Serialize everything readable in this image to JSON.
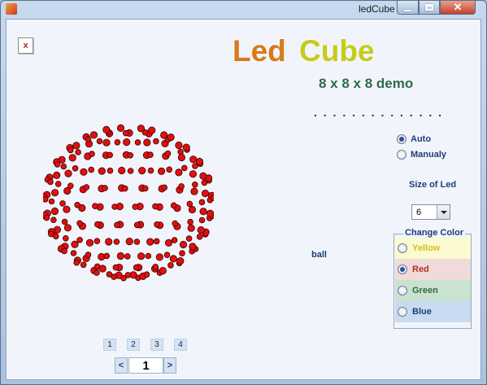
{
  "window": {
    "title": "ledCube"
  },
  "close_x": "x",
  "heading": {
    "led": "Led",
    "cube": "Cube",
    "subtitle": "8 x 8 x 8 demo"
  },
  "dots": ". . . . . . . . . . . . . .",
  "mode": [
    {
      "label": "Auto",
      "selected": true
    },
    {
      "label": "Manualy",
      "selected": false
    }
  ],
  "size": {
    "label": "Size of Led",
    "value": "6"
  },
  "pattern": {
    "label": "ball"
  },
  "change_color": {
    "legend": "Change Color",
    "options": [
      {
        "label": "Yellow",
        "selected": false,
        "text_color": "#d5c21a",
        "bg": "#fbfad0"
      },
      {
        "label": "Red",
        "selected": true,
        "text_color": "#b2322a",
        "bg": "#f0dada"
      },
      {
        "label": "Green",
        "selected": false,
        "text_color": "#2c6b3e",
        "bg": "#c9e3cf"
      },
      {
        "label": "Blue",
        "selected": false,
        "text_color": "#1f3c78",
        "bg": "#c9dbf1"
      }
    ]
  },
  "pager": {
    "pages": [
      "1",
      "2",
      "3",
      "4"
    ],
    "prev": "<",
    "next": ">",
    "current": "1"
  },
  "led_color": "#e01010"
}
